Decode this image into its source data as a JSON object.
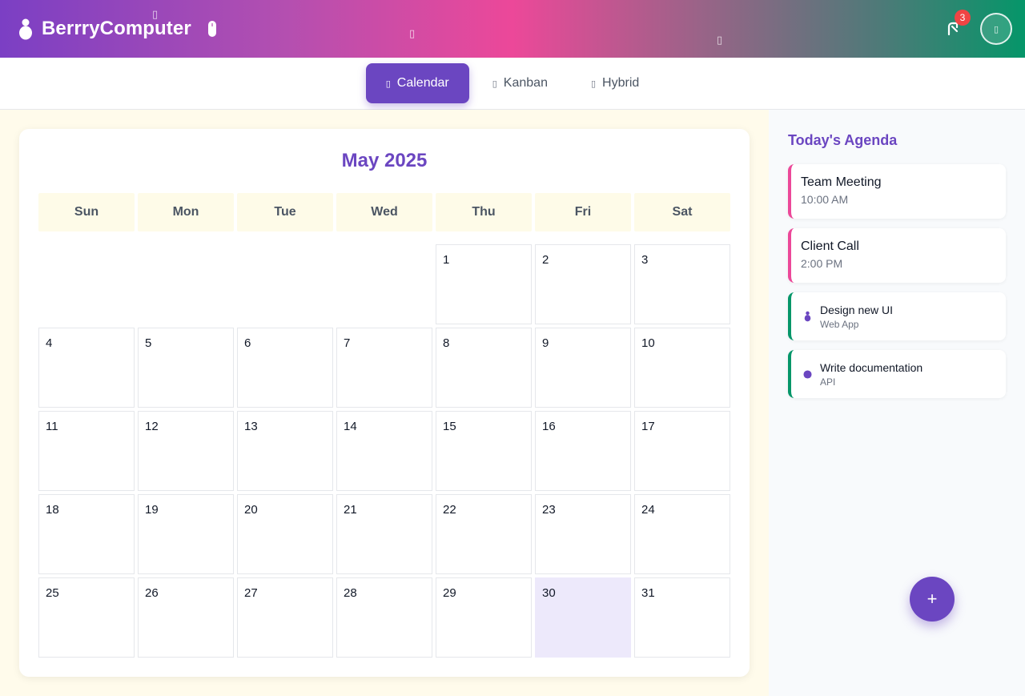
{
  "app": {
    "name": "BerrryComputer",
    "notification_count": "3"
  },
  "tabs": [
    {
      "label": "Calendar",
      "icon": "calendar-icon",
      "active": true
    },
    {
      "label": "Kanban",
      "icon": "kanban-icon",
      "active": false
    },
    {
      "label": "Hybrid",
      "icon": "hybrid-icon",
      "active": false
    }
  ],
  "calendar": {
    "title": "May 2025",
    "weekdays": [
      "Sun",
      "Mon",
      "Tue",
      "Wed",
      "Thu",
      "Fri",
      "Sat"
    ],
    "leading_blanks": 4,
    "days": [
      "1",
      "2",
      "3",
      "4",
      "5",
      "6",
      "7",
      "8",
      "9",
      "10",
      "11",
      "12",
      "13",
      "14",
      "15",
      "16",
      "17",
      "18",
      "19",
      "20",
      "21",
      "22",
      "23",
      "24",
      "25",
      "26",
      "27",
      "28",
      "29",
      "30",
      "31"
    ],
    "today": "30"
  },
  "agenda": {
    "title": "Today's Agenda",
    "events": [
      {
        "title": "Team Meeting",
        "time": "10:00 AM"
      },
      {
        "title": "Client Call",
        "time": "2:00 PM"
      }
    ],
    "tasks": [
      {
        "title": "Design new UI",
        "project": "Web App",
        "icon": "berry-icon"
      },
      {
        "title": "Write documentation",
        "project": "API",
        "icon": "dot-icon"
      }
    ]
  },
  "fab": {
    "label": "+"
  },
  "colors": {
    "accent": "#6b46c1",
    "event_border": "#ec4899",
    "task_border": "#059669",
    "today_bg": "#ede9fb",
    "badge": "#ef4444"
  }
}
